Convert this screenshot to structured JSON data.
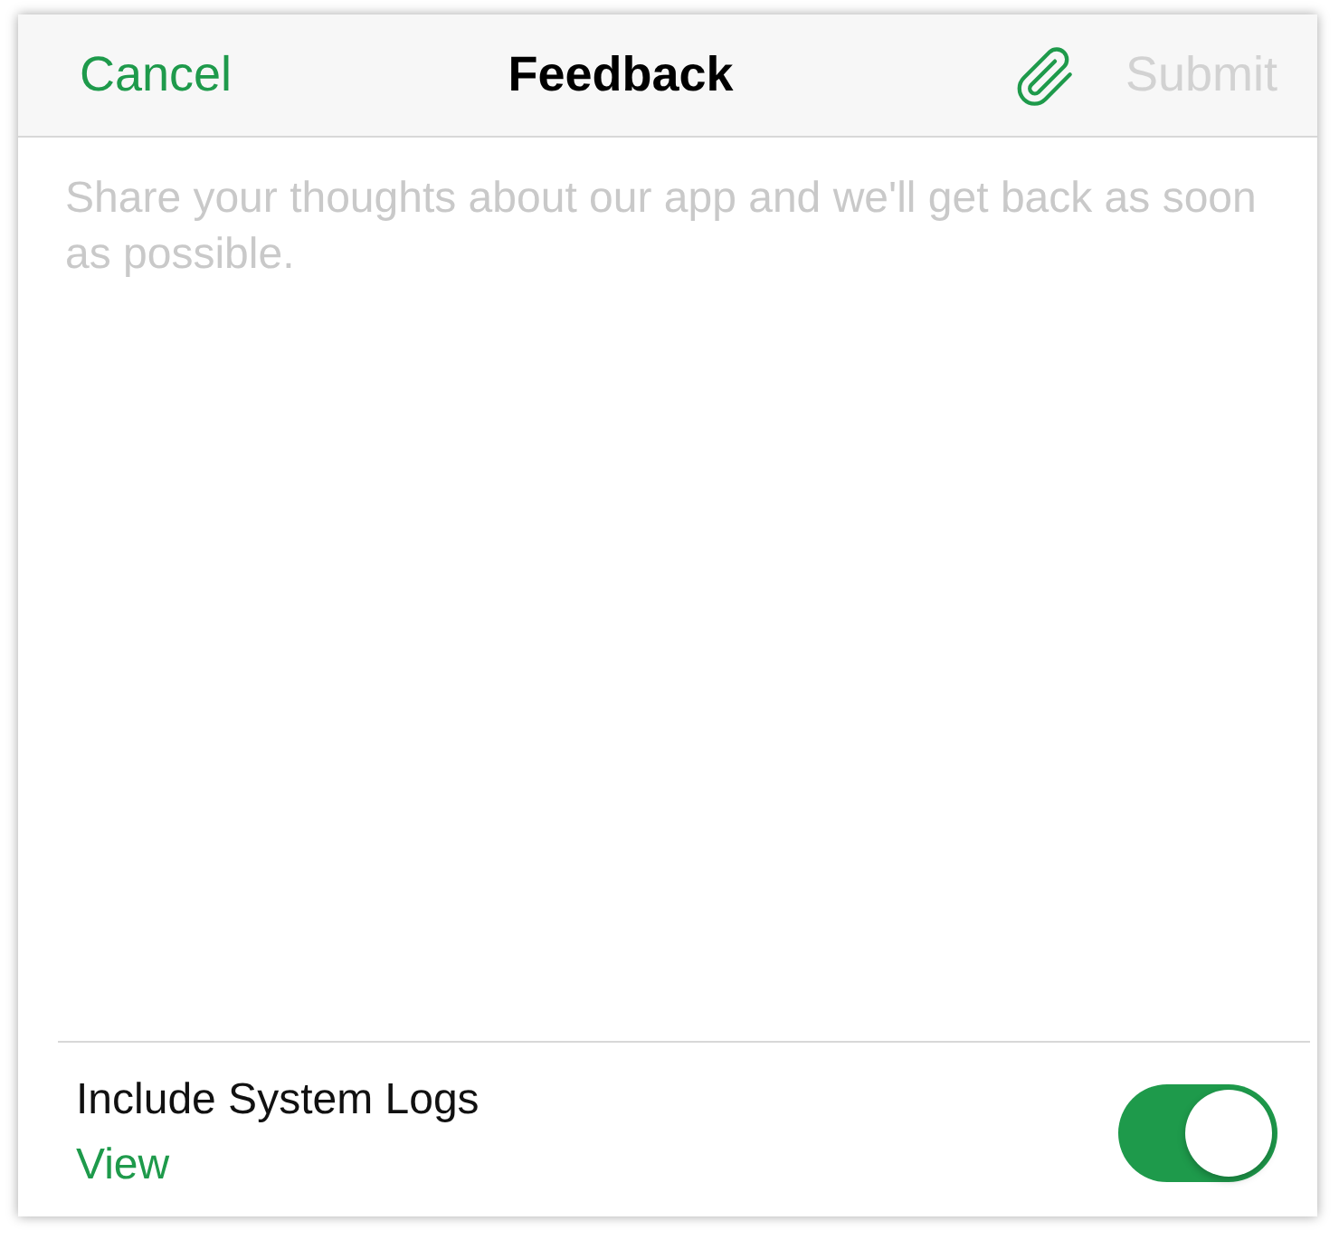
{
  "header": {
    "cancel": "Cancel",
    "title": "Feedback",
    "submit": {
      "label": "Submit",
      "disabled": true
    }
  },
  "message": {
    "placeholder": "Share your thoughts about our app and we'll get back as soon as possible."
  },
  "system_logs": {
    "label": "Include System Logs",
    "link": "View",
    "on": true
  }
}
